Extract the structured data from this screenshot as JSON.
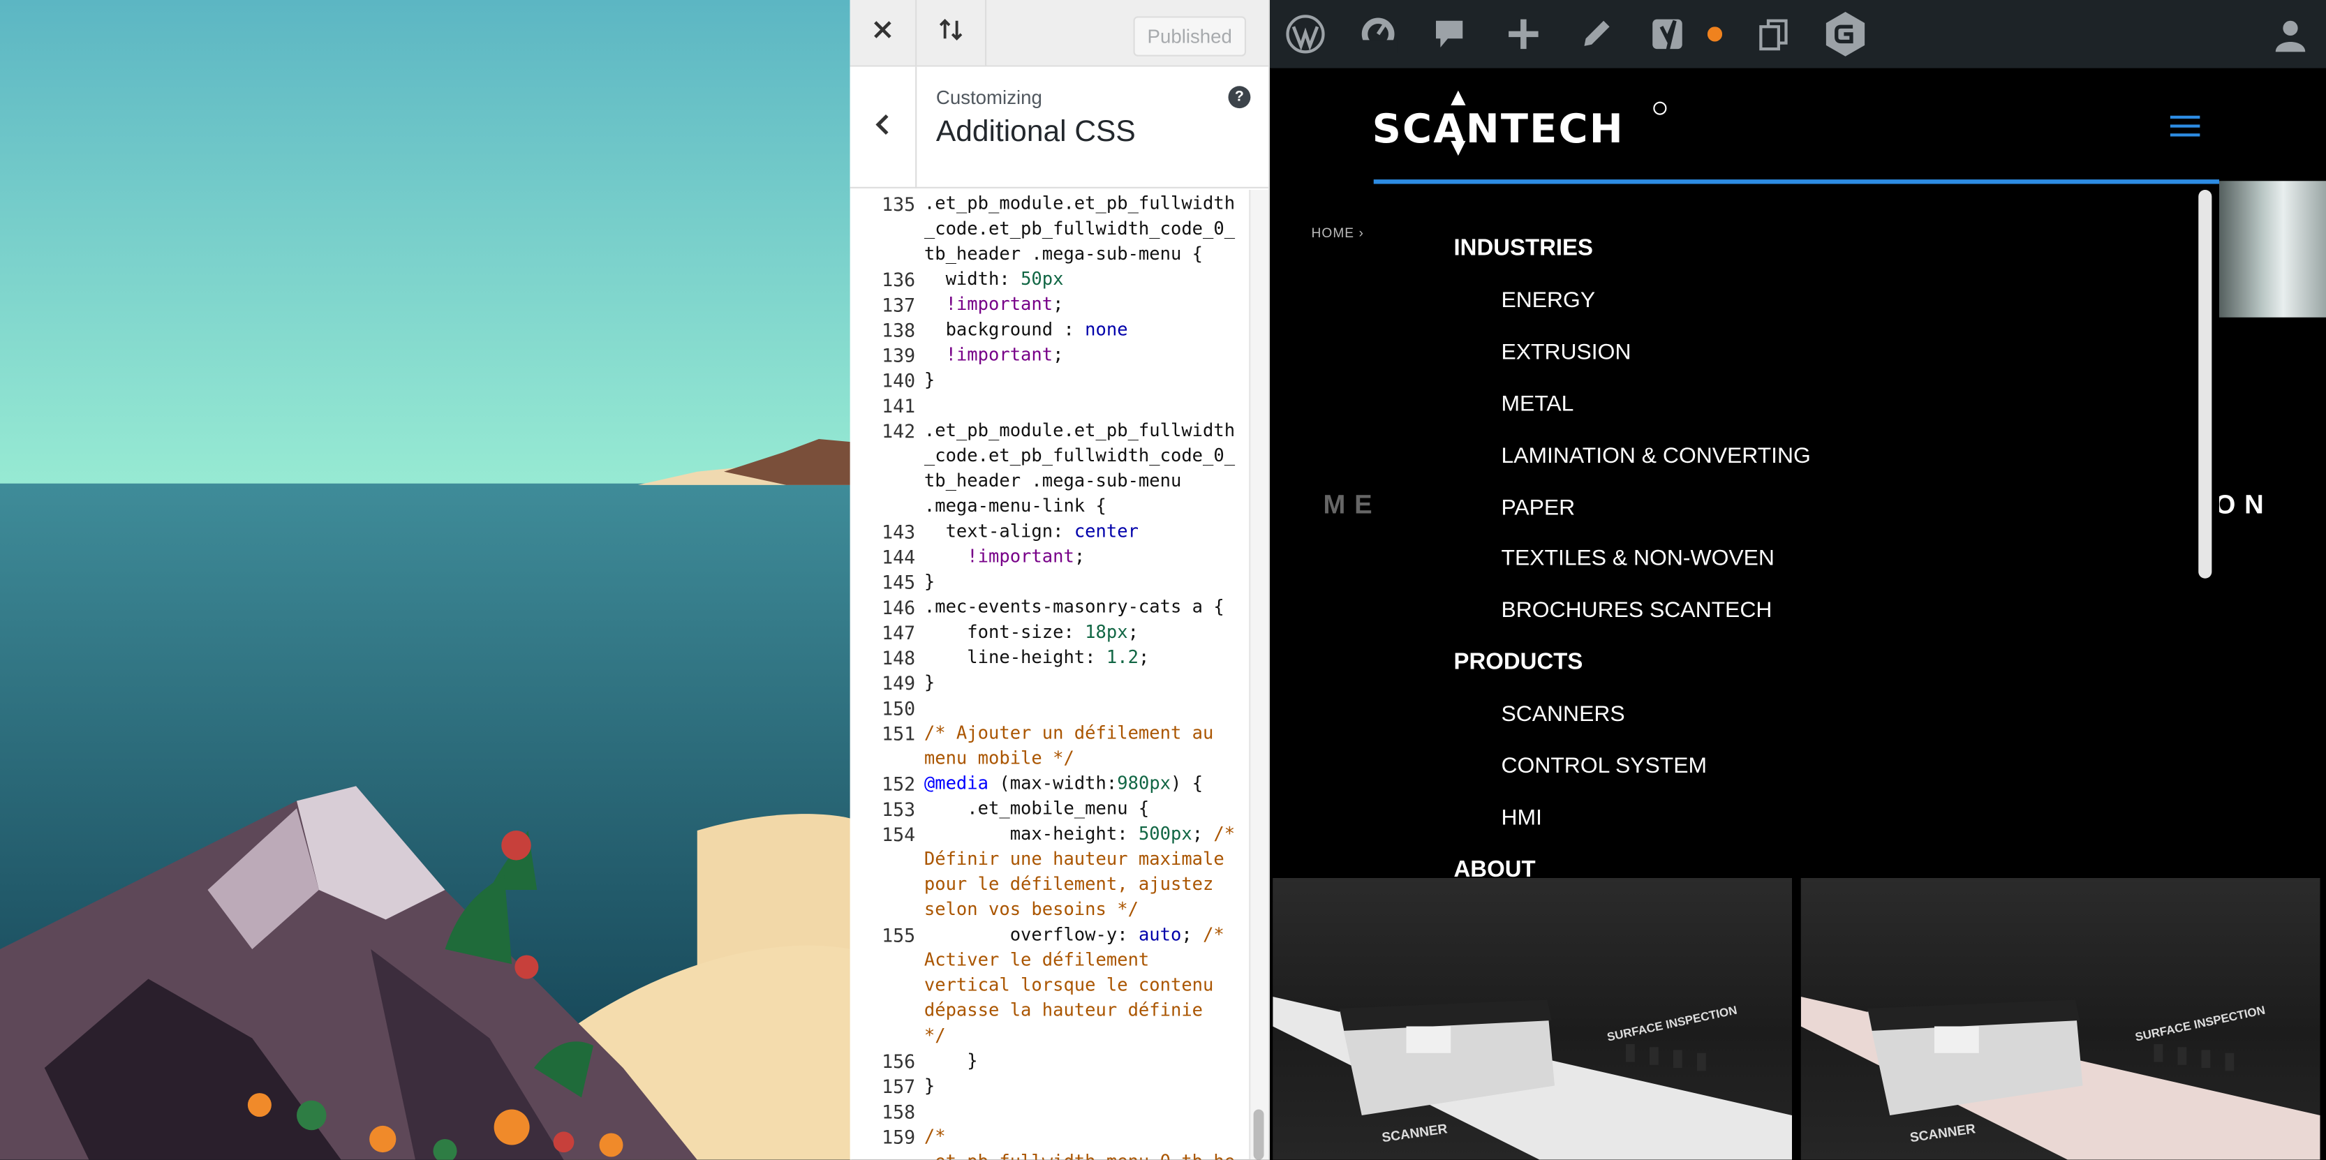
{
  "customizer": {
    "published_label": "Published",
    "subtitle": "Customizing",
    "title": "Additional CSS",
    "help_label": "?"
  },
  "code_lines": [
    {
      "n": "135",
      "t": [
        ".et_pb_module.et_pb_fullwidth",
        "_code.et_pb_fullwidth_code_0_",
        "tb_header .mega-sub-menu {"
      ]
    },
    {
      "n": "136",
      "t": [
        "  width: 50px"
      ]
    },
    {
      "n": "137",
      "t": [
        "  !important;"
      ]
    },
    {
      "n": "138",
      "t": [
        "  background : none"
      ]
    },
    {
      "n": "139",
      "t": [
        "  !important;"
      ]
    },
    {
      "n": "140",
      "t": [
        "}"
      ]
    },
    {
      "n": "141",
      "t": [
        ""
      ]
    },
    {
      "n": "142",
      "t": [
        ".et_pb_module.et_pb_fullwidth",
        "_code.et_pb_fullwidth_code_0_",
        "tb_header .mega-sub-menu",
        ".mega-menu-link {"
      ]
    },
    {
      "n": "143",
      "t": [
        "  text-align: center"
      ]
    },
    {
      "n": "144",
      "t": [
        "    !important;"
      ]
    },
    {
      "n": "145",
      "t": [
        "}"
      ]
    },
    {
      "n": "146",
      "t": [
        ".mec-events-masonry-cats a {"
      ]
    },
    {
      "n": "147",
      "t": [
        "    font-size: 18px;"
      ]
    },
    {
      "n": "148",
      "t": [
        "    line-height: 1.2;"
      ]
    },
    {
      "n": "149",
      "t": [
        "}"
      ]
    },
    {
      "n": "150",
      "t": [
        ""
      ]
    },
    {
      "n": "151",
      "t": [
        "/* Ajouter un défilement au",
        "menu mobile */"
      ]
    },
    {
      "n": "152",
      "t": [
        "@media (max-width:980px) {"
      ]
    },
    {
      "n": "153",
      "t": [
        "    .et_mobile_menu {"
      ]
    },
    {
      "n": "154",
      "t": [
        "        max-height: 500px; /*",
        "Définir une hauteur maximale",
        "pour le défilement, ajustez",
        "selon vos besoins */"
      ]
    },
    {
      "n": "155",
      "t": [
        "        overflow-y: auto; /*",
        "Activer le défilement",
        "vertical lorsque le contenu",
        "dépasse la hauteur définie",
        "*/"
      ]
    },
    {
      "n": "156",
      "t": [
        "    }"
      ]
    },
    {
      "n": "157",
      "t": [
        "}"
      ]
    },
    {
      "n": "158",
      "t": [
        ""
      ]
    },
    {
      "n": "159",
      "t": [
        "/*",
        ".et_pb_fullwidth_menu_0_tb_he"
      ]
    }
  ],
  "site": {
    "brand": "SCANTECH",
    "breadcrumb": "HOME",
    "ghost_left": "ME",
    "ghost_right": "ON",
    "menu": [
      {
        "label": "INDUSTRIES",
        "level": 0
      },
      {
        "label": "ENERGY",
        "level": 1
      },
      {
        "label": "EXTRUSION",
        "level": 1
      },
      {
        "label": "METAL",
        "level": 1
      },
      {
        "label": "LAMINATION & CONVERTING",
        "level": 1
      },
      {
        "label": "PAPER",
        "level": 1
      },
      {
        "label": "TEXTILES & NON-WOVEN",
        "level": 1
      },
      {
        "label": "BROCHURES SCANTECH",
        "level": 1
      },
      {
        "label": "PRODUCTS",
        "level": 0
      },
      {
        "label": "SCANNERS",
        "level": 1
      },
      {
        "label": "CONTROL SYSTEM",
        "level": 1
      },
      {
        "label": "HMI",
        "level": 1
      },
      {
        "label": "ABOUT",
        "level": 0
      }
    ],
    "product_images": [
      {
        "caption_surface": "SURFACE INSPECTION",
        "caption_scanner": "SCANNER"
      },
      {
        "caption_surface": "SURFACE INSPECTION",
        "caption_scanner": "SCANNER"
      }
    ]
  },
  "colors": {
    "accent": "#2d8ce3",
    "notification": "#f0821e",
    "admin_bar": "#1d2327"
  },
  "icons": [
    "close-icon",
    "reorder-icon",
    "back-chevron-icon",
    "help-icon",
    "wordpress-logo-icon",
    "dashboard-icon",
    "comments-icon",
    "new-content-icon",
    "edit-pencil-icon",
    "yoast-icon",
    "notification-dot-icon",
    "duplicate-page-icon",
    "gravity-forms-icon",
    "user-avatar-icon",
    "hamburger-menu-icon"
  ]
}
